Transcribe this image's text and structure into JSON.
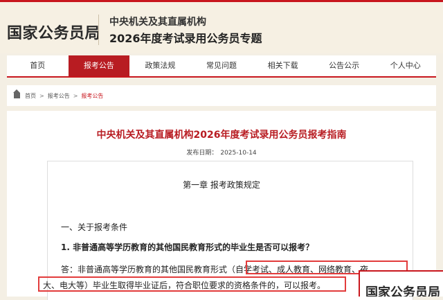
{
  "header": {
    "logo": "国家公务员局",
    "subtitle_line1": "中央机关及其直属机构",
    "subtitle_line2": "2026年度考试录用公务员专题"
  },
  "nav": {
    "items": [
      "首页",
      "报考公告",
      "政策法规",
      "常见问题",
      "相关下载",
      "公告公示",
      "个人中心"
    ],
    "active_index": 1
  },
  "breadcrumb": {
    "items": [
      "首页",
      "报考公告",
      "报考公告"
    ],
    "separator": ">"
  },
  "article": {
    "title": "中央机关及其直属机构2026年度考试录用公务员报考指南",
    "date_label": "发布日期：",
    "date_value": "2025-10-14",
    "chapter": "第一章  报考政策规定",
    "section": "一、关于报考条件",
    "question": "1. 非普通高等学历教育的其他国民教育形式的毕业生是否可以报考？",
    "answer_prefix": "答：非普通高等学历教育的其他国民教育形式（",
    "answer_highlight_1": "自学考试、成人教育、网络教育、夜",
    "answer_highlight_2": "大、电大等）毕业生取得毕业证后，符合职位要求的资格条件的，可以报考。"
  },
  "overlay": {
    "text": "国家公务员局"
  },
  "colors": {
    "brand_red": "#c8161d",
    "nav_active": "#b81c22",
    "highlight_box": "#e23b3b",
    "page_bg": "#f4efe4"
  },
  "icons": {
    "breadcrumb_home": "home-icon"
  }
}
